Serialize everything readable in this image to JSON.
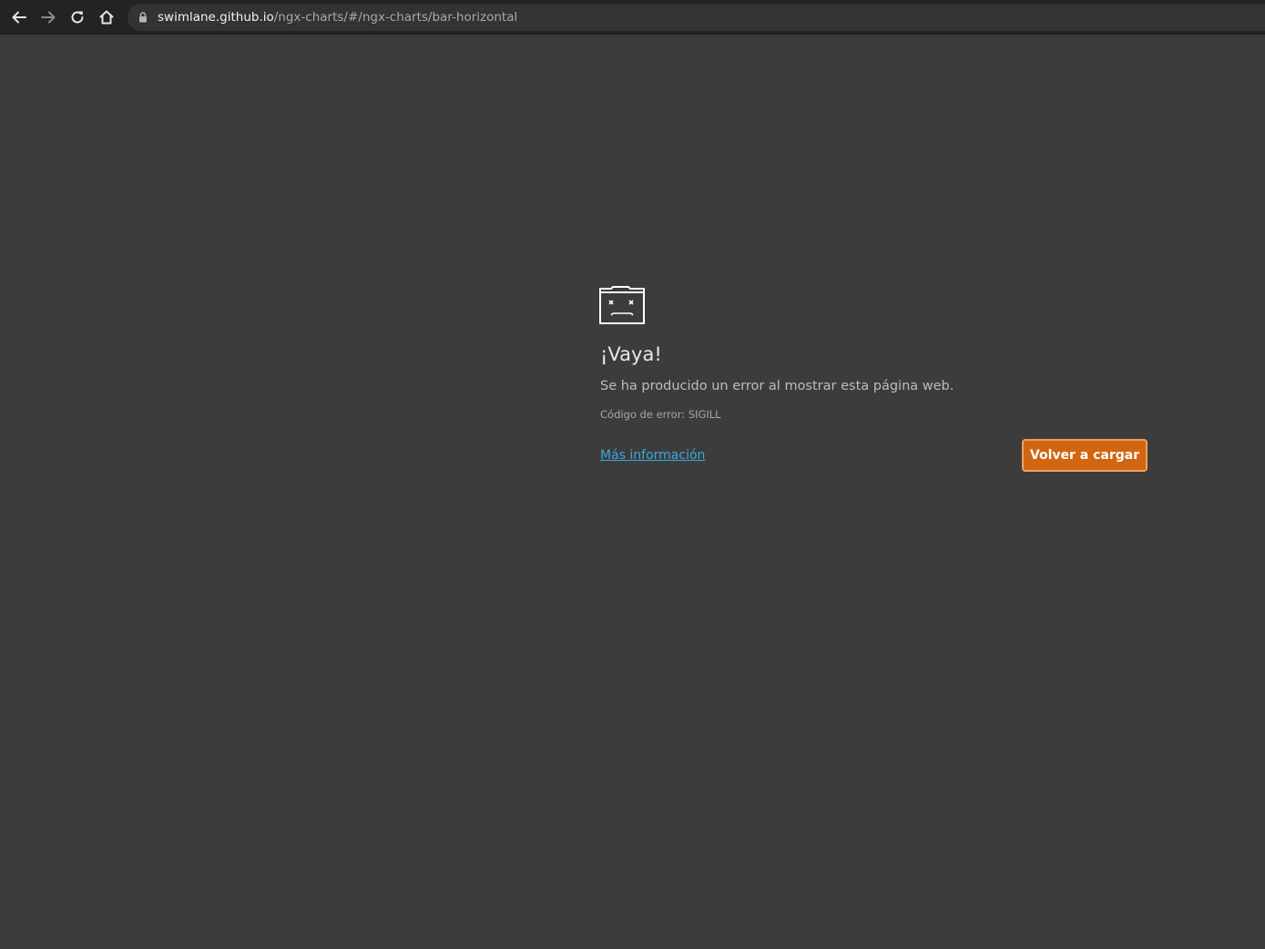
{
  "browser": {
    "url_host": "swimlane.github.io",
    "url_path": "/ngx-charts/#/ngx-charts/bar-horizontal",
    "icons": [
      "back-arrow-icon",
      "forward-arrow-icon",
      "reload-icon",
      "home-icon",
      "lock-icon"
    ]
  },
  "error_page": {
    "icon": "sad-tab-icon",
    "title": "¡Vaya!",
    "message": "Se ha producido un error al mostrar esta página web.",
    "error_code": "Código de error: SIGILL",
    "more_info_link": "Más información",
    "reload_button": "Volver a cargar"
  },
  "colors": {
    "background": "#3c3c3c",
    "toolbar": "#232323",
    "link": "#3aa7e0",
    "button": "#d2650f"
  }
}
